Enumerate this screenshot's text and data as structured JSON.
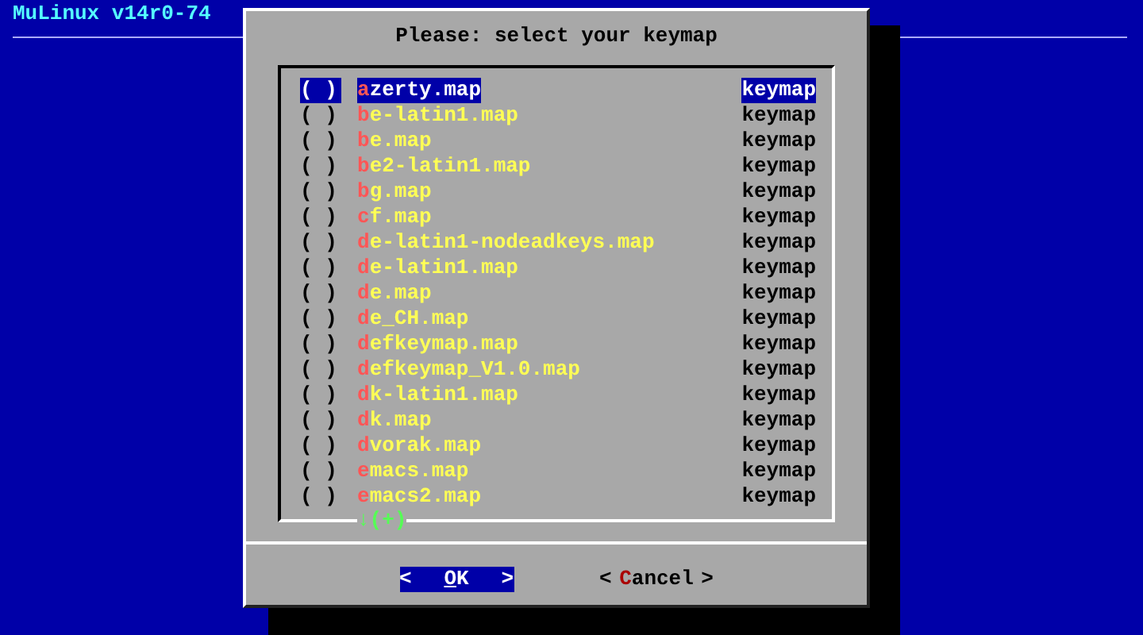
{
  "backtitle": "MuLinux v14r0-74",
  "dialog": {
    "title": "Please: select your keymap",
    "items": [
      {
        "radio": "( )",
        "name": "azerty.map",
        "tag": "keymap",
        "selected": true
      },
      {
        "radio": "( )",
        "name": "be-latin1.map",
        "tag": "keymap",
        "selected": false
      },
      {
        "radio": "( )",
        "name": "be.map",
        "tag": "keymap",
        "selected": false
      },
      {
        "radio": "( )",
        "name": "be2-latin1.map",
        "tag": "keymap",
        "selected": false
      },
      {
        "radio": "( )",
        "name": "bg.map",
        "tag": "keymap",
        "selected": false
      },
      {
        "radio": "( )",
        "name": "cf.map",
        "tag": "keymap",
        "selected": false
      },
      {
        "radio": "( )",
        "name": "de-latin1-nodeadkeys.map",
        "tag": "keymap",
        "selected": false
      },
      {
        "radio": "( )",
        "name": "de-latin1.map",
        "tag": "keymap",
        "selected": false
      },
      {
        "radio": "( )",
        "name": "de.map",
        "tag": "keymap",
        "selected": false
      },
      {
        "radio": "( )",
        "name": "de_CH.map",
        "tag": "keymap",
        "selected": false
      },
      {
        "radio": "( )",
        "name": "defkeymap.map",
        "tag": "keymap",
        "selected": false
      },
      {
        "radio": "( )",
        "name": "defkeymap_V1.0.map",
        "tag": "keymap",
        "selected": false
      },
      {
        "radio": "( )",
        "name": "dk-latin1.map",
        "tag": "keymap",
        "selected": false
      },
      {
        "radio": "( )",
        "name": "dk.map",
        "tag": "keymap",
        "selected": false
      },
      {
        "radio": "( )",
        "name": "dvorak.map",
        "tag": "keymap",
        "selected": false
      },
      {
        "radio": "( )",
        "name": "emacs.map",
        "tag": "keymap",
        "selected": false
      },
      {
        "radio": "( )",
        "name": "emacs2.map",
        "tag": "keymap",
        "selected": false
      }
    ],
    "scroll_indicator": "↓(+)",
    "buttons": [
      {
        "open": "<",
        "label": "OK",
        "close": ">",
        "selected": true
      },
      {
        "open": "<",
        "label": "Cancel",
        "close": ">",
        "selected": false
      }
    ]
  }
}
